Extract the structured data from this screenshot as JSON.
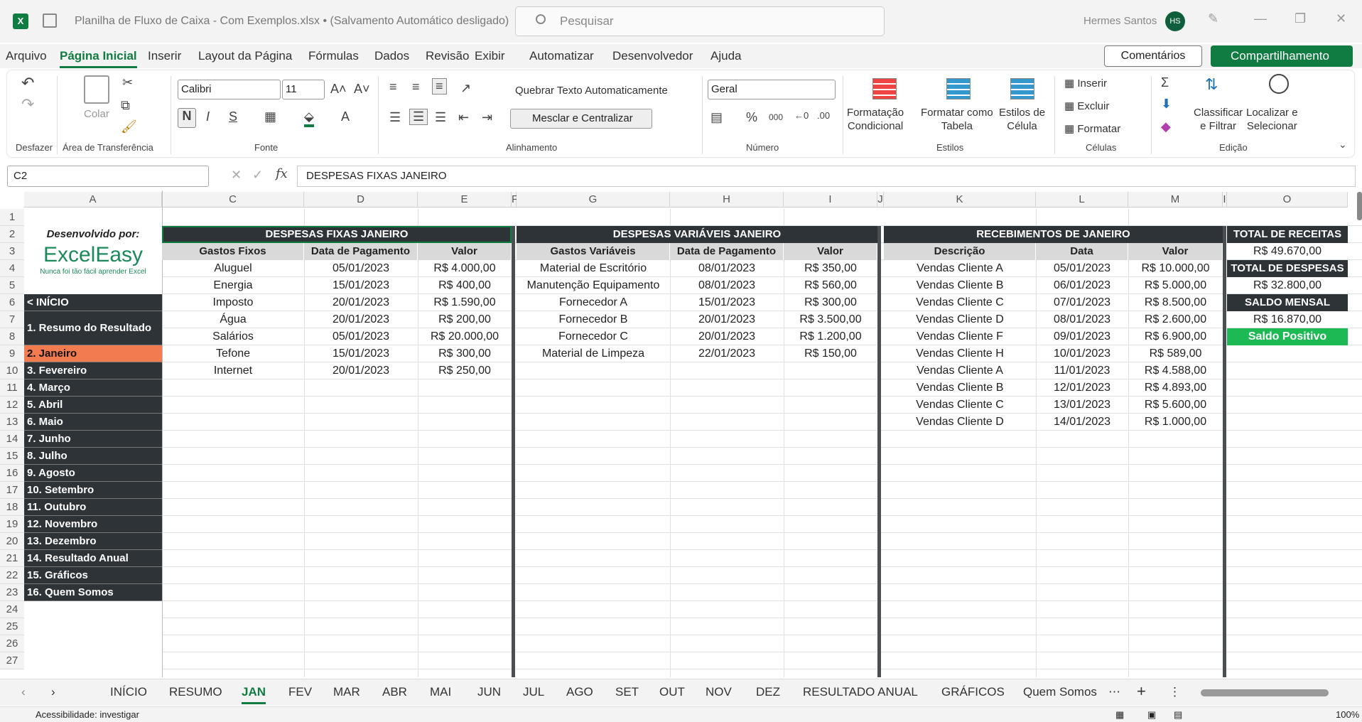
{
  "titlebar": {
    "logo": "X",
    "title": "Planilha de Fluxo de Caixa - Com Exemplos.xlsx  •  (Salvamento Automático desligado)",
    "search_placeholder": "Pesquisar",
    "user": "Hermes Santos",
    "avatar": "HS"
  },
  "menu": {
    "items": [
      "Arquivo",
      "Página Inicial",
      "Inserir",
      "Layout da Página",
      "Fórmulas",
      "Dados",
      "Revisão",
      "Exibir",
      "Automatizar",
      "Desenvolvedor",
      "Ajuda"
    ],
    "active": "Página Inicial",
    "comments": "Comentários",
    "share": "Compartilhamento"
  },
  "ribbon": {
    "groups": {
      "undo": "Desfazer",
      "clipboard": "Área de Transferência",
      "font": "Fonte",
      "align": "Alinhamento",
      "number": "Número",
      "styles": "Estilos",
      "cells": "Células",
      "edit": "Edição"
    },
    "paste": "Colar",
    "font_name": "Calibri",
    "font_size": "11",
    "bold": "N",
    "italic": "I",
    "underline": "S",
    "wrap": "Quebrar Texto Automaticamente",
    "merge": "Mesclar e Centralizar",
    "number_format": "Geral",
    "cond_format": "Formatação\nCondicional",
    "format_table": "Formatar como\nTabela",
    "cell_styles": "Estilos de\nCélula",
    "insert": "Inserir",
    "delete": "Excluir",
    "format": "Formatar",
    "sort": "Classificar\ne Filtrar",
    "find": "Localizar e\nSelecionar"
  },
  "formula_bar": {
    "name_box": "C2",
    "fx": "fx",
    "content": "DESPESAS FIXAS JANEIRO"
  },
  "columns": [
    "A",
    "",
    "C",
    "D",
    "E",
    "F",
    "G",
    "H",
    "I",
    "J",
    "K",
    "L",
    "M",
    "I",
    "O"
  ],
  "sidebar": {
    "developed_by": "Desenvolvido por:",
    "logo_text": "ExcelEasy",
    "logo_tagline": "Nunca foi tão fácil aprender Excel",
    "items": [
      "< INÍCIO",
      "1. Resumo do Resultado",
      "2. Janeiro",
      "3. Fevereiro",
      "4. Março",
      "5. Abril",
      "6. Maio",
      "7. Junho",
      "8. Julho",
      "9. Agosto",
      "10. Setembro",
      "11. Outubro",
      "12. Novembro",
      "13. Dezembro",
      "14. Resultado Anual",
      "15. Gráficos",
      "16. Quem Somos"
    ],
    "active_index": 2
  },
  "fixed": {
    "title": "DESPESAS FIXAS JANEIRO",
    "headers": [
      "Gastos Fixos",
      "Data de Pagamento",
      "Valor"
    ],
    "rows": [
      [
        "Aluguel",
        "05/01/2023",
        "R$ 4.000,00"
      ],
      [
        "Energia",
        "15/01/2023",
        "R$ 400,00"
      ],
      [
        "Imposto",
        "20/01/2023",
        "R$ 1.590,00"
      ],
      [
        "Água",
        "20/01/2023",
        "R$ 200,00"
      ],
      [
        "Salários",
        "05/01/2023",
        "R$ 20.000,00"
      ],
      [
        "Tefone",
        "15/01/2023",
        "R$ 300,00"
      ],
      [
        "Internet",
        "20/01/2023",
        "R$ 250,00"
      ]
    ]
  },
  "variable": {
    "title": "DESPESAS VARIÁVEIS JANEIRO",
    "headers": [
      "Gastos Variáveis",
      "Data de Pagamento",
      "Valor"
    ],
    "rows": [
      [
        "Material de Escritório",
        "08/01/2023",
        "R$ 350,00"
      ],
      [
        "Manutenção Equipamento",
        "08/01/2023",
        "R$ 560,00"
      ],
      [
        "Fornecedor A",
        "15/01/2023",
        "R$ 300,00"
      ],
      [
        "Fornecedor B",
        "20/01/2023",
        "R$ 3.500,00"
      ],
      [
        "Fornecedor C",
        "20/01/2023",
        "R$ 1.200,00"
      ],
      [
        "Material de Limpeza",
        "22/01/2023",
        "R$ 150,00"
      ]
    ]
  },
  "receipts": {
    "title": "RECEBIMENTOS DE JANEIRO",
    "headers": [
      "Descrição",
      "Data",
      "Valor"
    ],
    "rows": [
      [
        "Vendas Cliente A",
        "05/01/2023",
        "R$ 10.000,00"
      ],
      [
        "Vendas Cliente B",
        "06/01/2023",
        "R$ 5.000,00"
      ],
      [
        "Vendas Cliente C",
        "07/01/2023",
        "R$ 8.500,00"
      ],
      [
        "Vendas Cliente D",
        "08/01/2023",
        "R$ 2.600,00"
      ],
      [
        "Vendas Cliente F",
        "09/01/2023",
        "R$ 6.900,00"
      ],
      [
        "Vendas Cliente H",
        "10/01/2023",
        "R$ 589,00"
      ],
      [
        "Vendas Cliente A",
        "11/01/2023",
        "R$ 4.588,00"
      ],
      [
        "Vendas Cliente B",
        "12/01/2023",
        "R$ 4.893,00"
      ],
      [
        "Vendas Cliente C",
        "13/01/2023",
        "R$ 5.600,00"
      ],
      [
        "Vendas Cliente D",
        "14/01/2023",
        "R$ 1.000,00"
      ]
    ]
  },
  "summary": {
    "total_receipts_label": "TOTAL DE RECEITAS",
    "total_receipts": "R$ 49.670,00",
    "total_expenses_label": "TOTAL DE DESPESAS",
    "total_expenses": "R$ 32.800,00",
    "balance_label": "SALDO MENSAL",
    "balance": "R$ 16.870,00",
    "status": "Saldo Positivo",
    "status_color": "#1db954"
  },
  "sheet_tabs": {
    "items": [
      "INÍCIO",
      "RESUMO",
      "JAN",
      "FEV",
      "MAR",
      "ABR",
      "MAI",
      "JUN",
      "JUL",
      "AGO",
      "SET",
      "OUT",
      "NOV",
      "DEZ",
      "RESULTADO ANUAL",
      "GRÁFICOS",
      "Quem Somos"
    ],
    "active": "JAN"
  },
  "status_bar": {
    "accessibility": "Acessibilidade: investigar",
    "zoom": "100%"
  }
}
